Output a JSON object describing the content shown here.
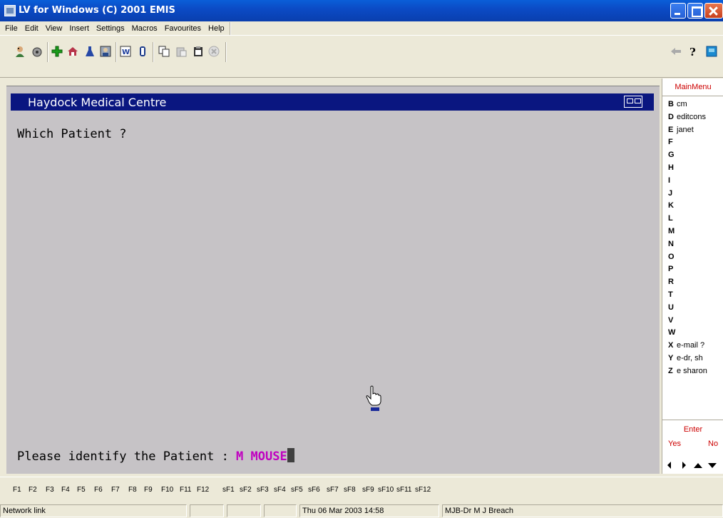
{
  "window": {
    "title": "LV for Windows (C) 2001 EMIS"
  },
  "menubar": {
    "items": [
      "File",
      "Edit",
      "View",
      "Insert",
      "Settings",
      "Macros",
      "Favourites",
      "Help"
    ]
  },
  "toolbar": {
    "icons": [
      "patient-icon",
      "lock-icon",
      "add-icon",
      "home-visit-icon",
      "lab-flask-icon",
      "person-icon",
      "word-icon",
      "clip-icon",
      "copy-icon",
      "paste-icon",
      "clipboard-icon",
      "cancel-icon",
      "back-arrow-icon",
      "help-icon",
      "book-icon"
    ]
  },
  "main": {
    "practice_name": "Haydock Medical Centre",
    "question": "Which Patient ?",
    "prompt_label": "Please identify the Patient : ",
    "patient_value": "M MOUSE"
  },
  "side_menu": {
    "title": "MainMenu",
    "keys": [
      {
        "letter": "B",
        "label": "cm"
      },
      {
        "letter": "D",
        "label": "editcons"
      },
      {
        "letter": "E",
        "label": "janet"
      },
      {
        "letter": "F",
        "label": ""
      },
      {
        "letter": "G",
        "label": ""
      },
      {
        "letter": "H",
        "label": ""
      },
      {
        "letter": "I",
        "label": ""
      },
      {
        "letter": "J",
        "label": ""
      },
      {
        "letter": "K",
        "label": ""
      },
      {
        "letter": "L",
        "label": ""
      },
      {
        "letter": "M",
        "label": ""
      },
      {
        "letter": "N",
        "label": ""
      },
      {
        "letter": "O",
        "label": ""
      },
      {
        "letter": "P",
        "label": ""
      },
      {
        "letter": "R",
        "label": ""
      },
      {
        "letter": "T",
        "label": ""
      },
      {
        "letter": "U",
        "label": ""
      },
      {
        "letter": "V",
        "label": ""
      },
      {
        "letter": "W",
        "label": ""
      },
      {
        "letter": "X",
        "label": "e-mail ?"
      },
      {
        "letter": "Y",
        "label": "e-dr, sh"
      },
      {
        "letter": "Z",
        "label": "e sharon"
      }
    ],
    "enter": "Enter",
    "yes": "Yes",
    "no": "No"
  },
  "fkeys": [
    "F1",
    "F2",
    "F3",
    "F4",
    "F5",
    "F6",
    "F7",
    "F8",
    "F9",
    "F10",
    "F11",
    "F12",
    "sF1",
    "sF2",
    "sF3",
    "sF4",
    "sF5",
    "sF6",
    "sF7",
    "sF8",
    "sF9",
    "sF10",
    "sF11",
    "sF12"
  ],
  "statusbar": {
    "network": "Network link",
    "datetime": "Thu 06 Mar 2003 14:58",
    "user": "MJB-Dr M J Breach"
  }
}
